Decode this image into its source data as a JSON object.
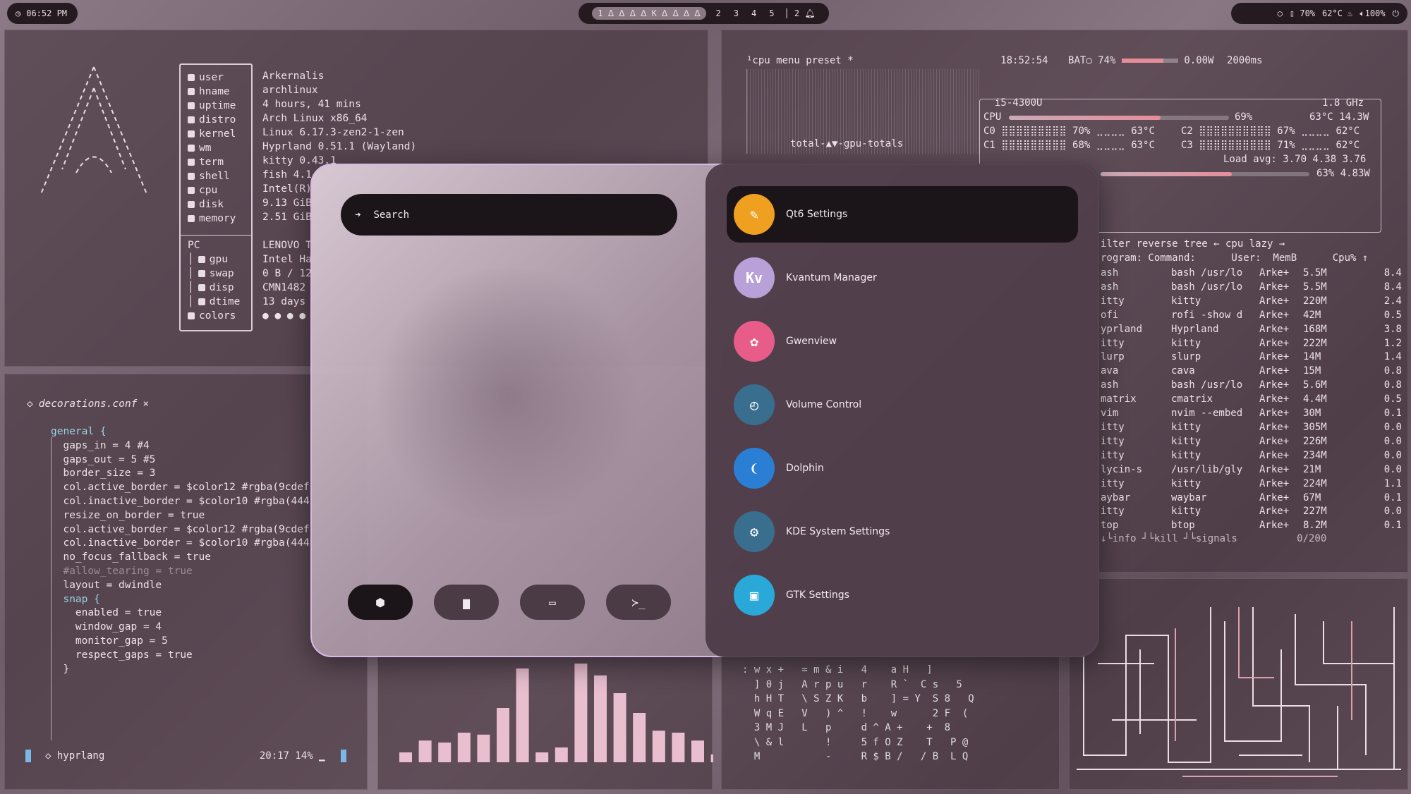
{
  "topbar": {
    "clock": "06:52 PM",
    "workspaces": [
      "1",
      "2",
      "3",
      "4",
      "5"
    ],
    "active_workspace": "1",
    "workspace_icons": "ᐃ ᐃ ᐃ ᐃ K ᐃ ᐃ ᐃ ᐃ",
    "notification_count": "2",
    "volume": "100%",
    "brightness": "70%",
    "temperature": "62°C"
  },
  "fetch": {
    "keys": [
      "user",
      "hname",
      "uptime",
      "distro",
      "kernel",
      "wm",
      "term",
      "shell",
      "cpu",
      "disk",
      "memory"
    ],
    "values": [
      "Arkernalis",
      "archlinux",
      "4 hours, 41 mins",
      "Arch Linux x86_64",
      "Linux 6.17.3-zen2-1-zen",
      "Hyprland 0.51.1 (Wayland)",
      "kitty 0.43.1",
      "fish 4.1",
      "Intel(R)",
      "9.13 GiB",
      "2.51 GiB"
    ],
    "pc_label": "PC",
    "pc_keys": [
      "gpu",
      "swap",
      "disp",
      "dtime",
      "colors"
    ],
    "pc_values": [
      "LENOVO T",
      "Intel Ha",
      "0 B / 12",
      "CMN1482",
      "13 days",
      "● ● ● ●"
    ]
  },
  "editor": {
    "filename": "decorations.conf",
    "close": "×",
    "lines": [
      "general {",
      "  gaps_in = 4 #4",
      "  gaps_out = 5 #5",
      "  border_size = 3",
      "",
      "  col.active_border = $color12 #rgba(9cdef",
      "  col.inactive_border = $color10 #rgba(444",
      "  resize_on_border = true",
      "",
      "  col.active_border = $color12 #rgba(9cdef",
      "  col.inactive_border = $color10 #rgba(444",
      "",
      "  no_focus_fallback = true",
      "  #allow_tearing = true",
      "",
      "  layout = dwindle",
      "",
      "  snap {",
      "    enabled = true",
      "    window_gap = 4",
      "    monitor_gap = 5",
      "    respect_gaps = true",
      "  }"
    ],
    "status_lang": "hyprlang",
    "status_pos": "20:17 14%"
  },
  "btop": {
    "header": "¹cpu  menu  preset *",
    "time": "18:52:54",
    "battery": "BAT○ 74%",
    "power": "0.00W",
    "interval": "2000ms",
    "gpu_label": "total-▲▼-gpu-totals",
    "cpu_name": "i5-4300U",
    "cpu_freq": "1.8 GHz",
    "cpu_total_label": "CPU",
    "cpu_total_pct": "69%",
    "cpu_total_temp": "63°C 14.3W",
    "cores": [
      {
        "name": "C0",
        "pct": "70%",
        "temp": "63°C"
      },
      {
        "name": "C2",
        "pct": "67%",
        "temp": "62°C"
      },
      {
        "name": "C1",
        "pct": "68%",
        "temp": "63°C"
      },
      {
        "name": "C3",
        "pct": "71%",
        "temp": "62°C"
      }
    ],
    "load_avg": "Load avg: 3.70 4.38 3.76",
    "gpu_line": "63% 4.83W",
    "proc_header": "ilter        reverse tree ←  cpu lazy →",
    "proc_columns": "rogram: Command:      User:  MemB      Cpu% ↑",
    "processes": [
      [
        "ash",
        "bash /usr/lo",
        "Arke+",
        "5.5M",
        "8.4"
      ],
      [
        "ash",
        "bash /usr/lo",
        "Arke+",
        "5.5M",
        "8.4"
      ],
      [
        "itty",
        "kitty",
        "Arke+",
        "220M",
        "2.4"
      ],
      [
        "ofi",
        "rofi -show d",
        "Arke+",
        "42M",
        "0.5"
      ],
      [
        "yprland",
        "Hyprland",
        "Arke+",
        "168M",
        "3.8"
      ],
      [
        "itty",
        "kitty",
        "Arke+",
        "222M",
        "1.2"
      ],
      [
        "lurp",
        "slurp",
        "Arke+",
        "14M",
        "1.4"
      ],
      [
        "ava",
        "cava",
        "Arke+",
        "15M",
        "0.8"
      ],
      [
        "ash",
        "bash /usr/lo",
        "Arke+",
        "5.6M",
        "0.8"
      ],
      [
        "matrix",
        "cmatrix",
        "Arke+",
        "4.4M",
        "0.5"
      ],
      [
        "vim",
        "nvim --embed",
        "Arke+",
        "30M",
        "0.1"
      ],
      [
        "itty",
        "kitty",
        "Arke+",
        "305M",
        "0.0"
      ],
      [
        "itty",
        "kitty",
        "Arke+",
        "226M",
        "0.0"
      ],
      [
        "itty",
        "kitty",
        "Arke+",
        "234M",
        "0.0"
      ],
      [
        "lycin-s",
        "/usr/lib/gly",
        "Arke+",
        "21M",
        "0.0"
      ],
      [
        "itty",
        "kitty",
        "Arke+",
        "224M",
        "1.1"
      ],
      [
        "aybar",
        "waybar",
        "Arke+",
        "67M",
        "0.1"
      ],
      [
        "itty",
        "kitty",
        "Arke+",
        "227M",
        "0.0"
      ],
      [
        "top",
        "btop",
        "Arke+",
        "8.2M",
        "0.1"
      ]
    ],
    "proc_footer": "↓└info ┘└kill ┘└signals          0/200"
  },
  "cava": {
    "levels": [
      0.1,
      0.22,
      0.2,
      0.3,
      0.28,
      0.55,
      0.95,
      0.1,
      0.15,
      1.0,
      0.88,
      0.7,
      0.5,
      0.32,
      0.3,
      0.22,
      0.08
    ]
  },
  "matrix": {
    "lines": [
      ": w x +   = m & i   4    a H   ]",
      "  ] 0 j   A r p u   r    R `  C s   5",
      "  h H T   \\ S Z K   b    ] = Y  S 8   Q",
      "  W q E   V   ) ^   !    w      2 F  (",
      "  3 M J   L   p     d ^ A +    +  8",
      "  \\ & l       !     5 f O Z    T   P @",
      "  M           -     R $ B /   / B  L Q"
    ]
  },
  "launcher": {
    "search_placeholder": "Search",
    "apps": [
      {
        "name": "Qt6 Settings",
        "icon": "qt6-settings-icon",
        "color": "#f0a020"
      },
      {
        "name": "Kvantum Manager",
        "icon": "kvantum-icon",
        "color": "#b8a0d8"
      },
      {
        "name": "Gwenview",
        "icon": "gwenview-icon",
        "color": "#e85c8a"
      },
      {
        "name": "Volume Control",
        "icon": "volume-control-icon",
        "color": "#3a6e8e"
      },
      {
        "name": "Dolphin",
        "icon": "dolphin-icon",
        "color": "#2a7fd4"
      },
      {
        "name": "KDE System Settings",
        "icon": "kde-settings-icon",
        "color": "#3a6e8e"
      },
      {
        "name": "GTK Settings",
        "icon": "gtk-settings-icon",
        "color": "#2aa8d8"
      }
    ],
    "quick_buttons": [
      "apps",
      "files",
      "windows",
      "terminal"
    ],
    "quick_glyphs": [
      "⬢",
      "▆",
      "▭",
      "≻_"
    ],
    "selected_index": 0
  }
}
